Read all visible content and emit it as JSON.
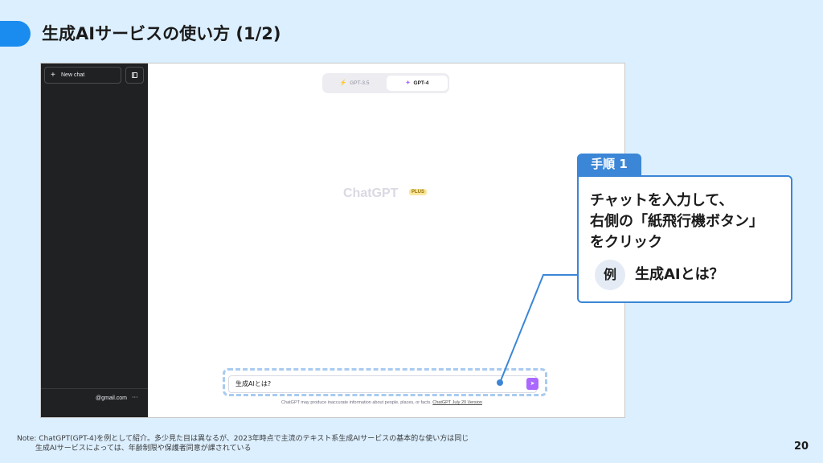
{
  "slide": {
    "title": "生成AIサービスの使い方 (1/2)",
    "page_number": "20",
    "note_label": "Note:",
    "note_lines": [
      "ChatGPT(GPT-4)を例として紹介。多少見た目は異なるが、2023年時点で主流のテキスト系生成AIサービスの基本的な使い方は同じ",
      "生成AIサービスによっては、年齢制限や保護者同意が課されている"
    ]
  },
  "chatgpt": {
    "sidebar": {
      "new_chat_icon": "plus-icon",
      "new_chat_label": "New chat",
      "toggle_icon": "sidebar-toggle-icon",
      "account_email": "@gmail.com",
      "account_more": "···"
    },
    "model_switch": {
      "tabs": [
        {
          "label": "GPT-3.5",
          "icon": "lightning-icon",
          "selected": false
        },
        {
          "label": "GPT-4",
          "icon": "sparkle-icon",
          "selected": true
        }
      ]
    },
    "brand": "ChatGPT",
    "plan_badge": "PLUS",
    "input_value": "生成AIとは?",
    "send_icon": "send-icon",
    "disclaimer": "ChatGPT may produce inaccurate information about people, places, or facts.",
    "disclaimer_link": "ChatGPT July 20 Version"
  },
  "callout": {
    "step_label": "手順 1",
    "instruction": "チャットを入力して、\n右側の「紙飛行機ボタン」\nをクリック",
    "example_label": "例",
    "example_text": "生成AIとは？"
  },
  "colors": {
    "accent": "#1a8cf0",
    "callout_blue": "#3b86d6",
    "send_purple": "#ab68ff",
    "sidebar_dark": "#202123",
    "background": "#dcefff"
  }
}
